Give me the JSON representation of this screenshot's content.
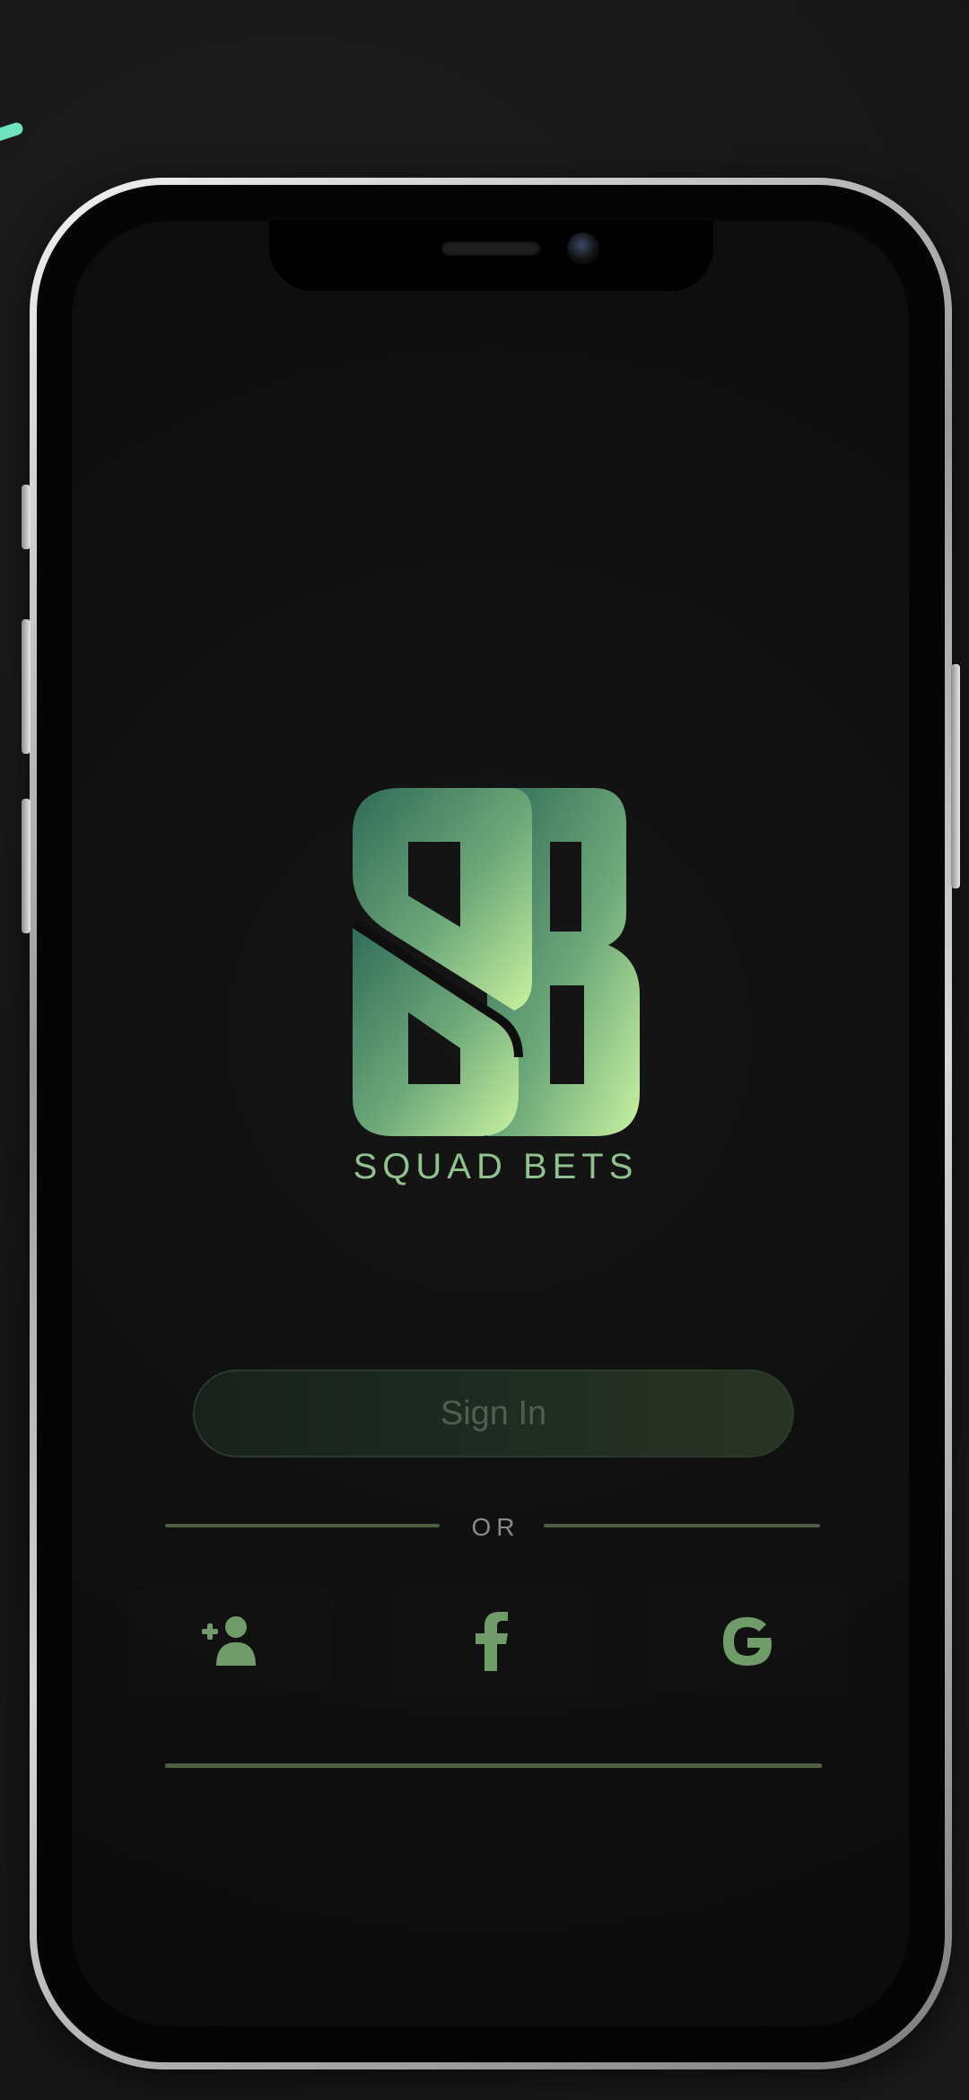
{
  "brand": {
    "logo_letters": "SB",
    "name": "SQUAD BETS"
  },
  "auth": {
    "signin_label": "Sign In",
    "or_label": "OR"
  },
  "social": [
    {
      "icon": "add-user-icon"
    },
    {
      "icon": "facebook-icon"
    },
    {
      "icon": "google-icon"
    }
  ],
  "colors": {
    "accent": "#8fc28c",
    "logo_gradient_start": "#2f6a58",
    "logo_gradient_end": "#c8f2a0",
    "divider": "#4d6140",
    "background": "#0e0e0e"
  }
}
